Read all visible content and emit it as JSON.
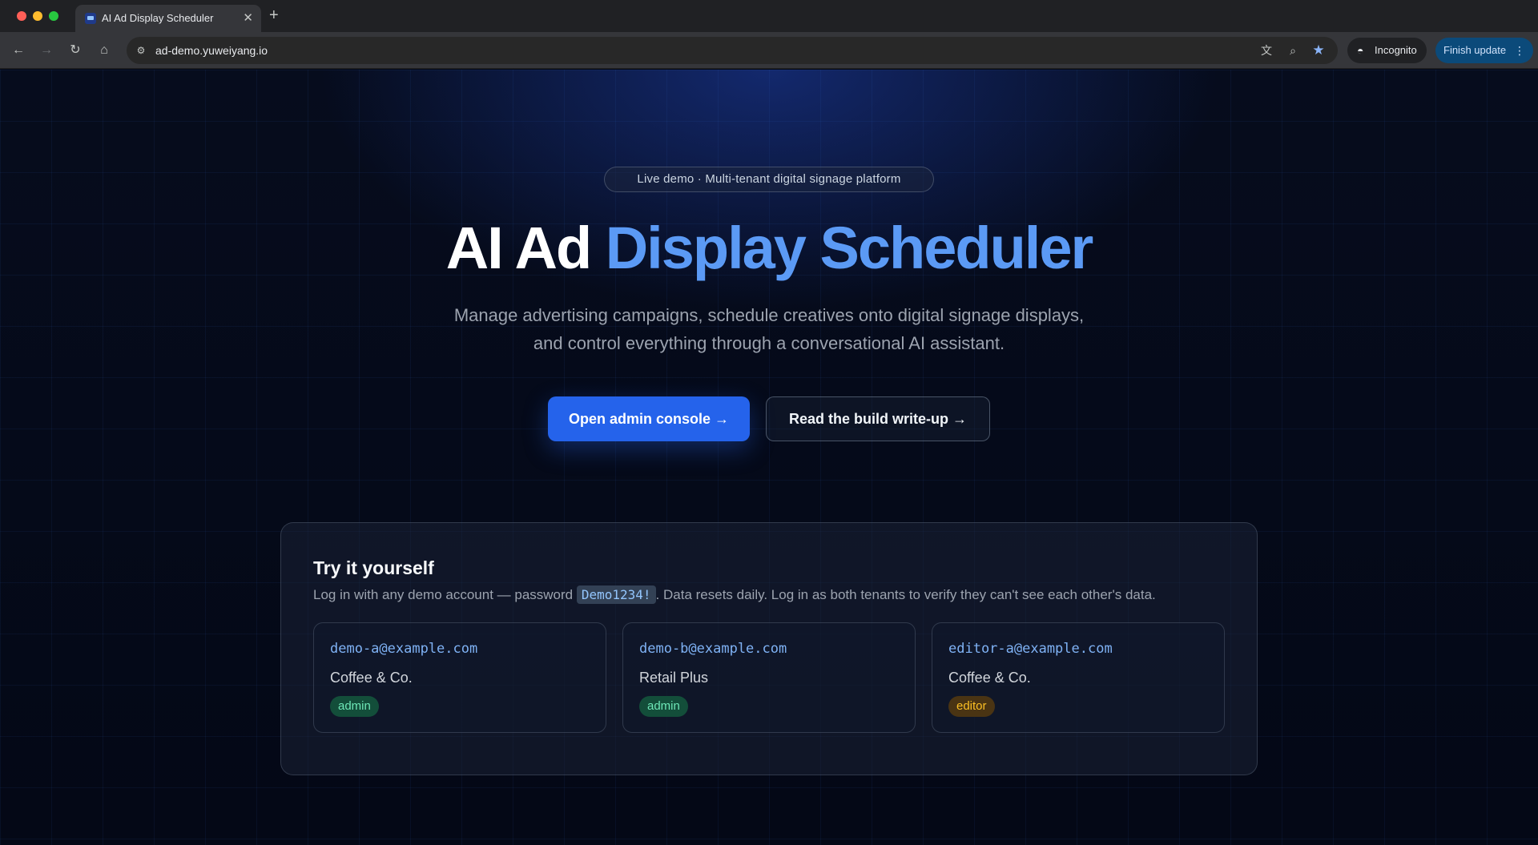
{
  "browser": {
    "tab_title": "AI Ad Display Scheduler",
    "tab_close": "✕",
    "new_tab": "+",
    "url": "ad-demo.yuweiyang.io",
    "incognito_label": "Incognito",
    "finish_update_label": "Finish update"
  },
  "hero": {
    "badge": "Live demo · Multi-tenant digital signage platform",
    "title_part1": "AI Ad",
    "title_part2": "Display Scheduler",
    "subtitle_line1": "Manage advertising campaigns, schedule creatives onto digital signage displays,",
    "subtitle_line2": "and control everything through a conversational AI assistant.",
    "primary_button": "Open admin console →",
    "secondary_button": "Read the build write-up →"
  },
  "try_it": {
    "title": "Try it yourself",
    "desc_before": "Log in with any demo account — password ",
    "password": "Demo1234!",
    "desc_after": ". Data resets daily. Log in as both tenants to verify they can't see each other's data.",
    "accounts": [
      {
        "email": "demo-a@example.com",
        "org": "Coffee & Co.",
        "role": "admin"
      },
      {
        "email": "demo-b@example.com",
        "org": "Retail Plus",
        "role": "admin"
      },
      {
        "email": "editor-a@example.com",
        "org": "Coffee & Co.",
        "role": "editor"
      }
    ]
  },
  "colors": {
    "accent": "#2563eb",
    "title_blue": "#5b9af5",
    "admin_badge": "#6ee7b7",
    "editor_badge": "#fbbf24"
  },
  "icons": [
    "back-arrow-icon",
    "forward-arrow-icon",
    "reload-icon",
    "home-icon",
    "site-info-icon",
    "translate-icon",
    "zoom-icon",
    "star-icon",
    "incognito-icon",
    "kebab-menu-icon"
  ]
}
